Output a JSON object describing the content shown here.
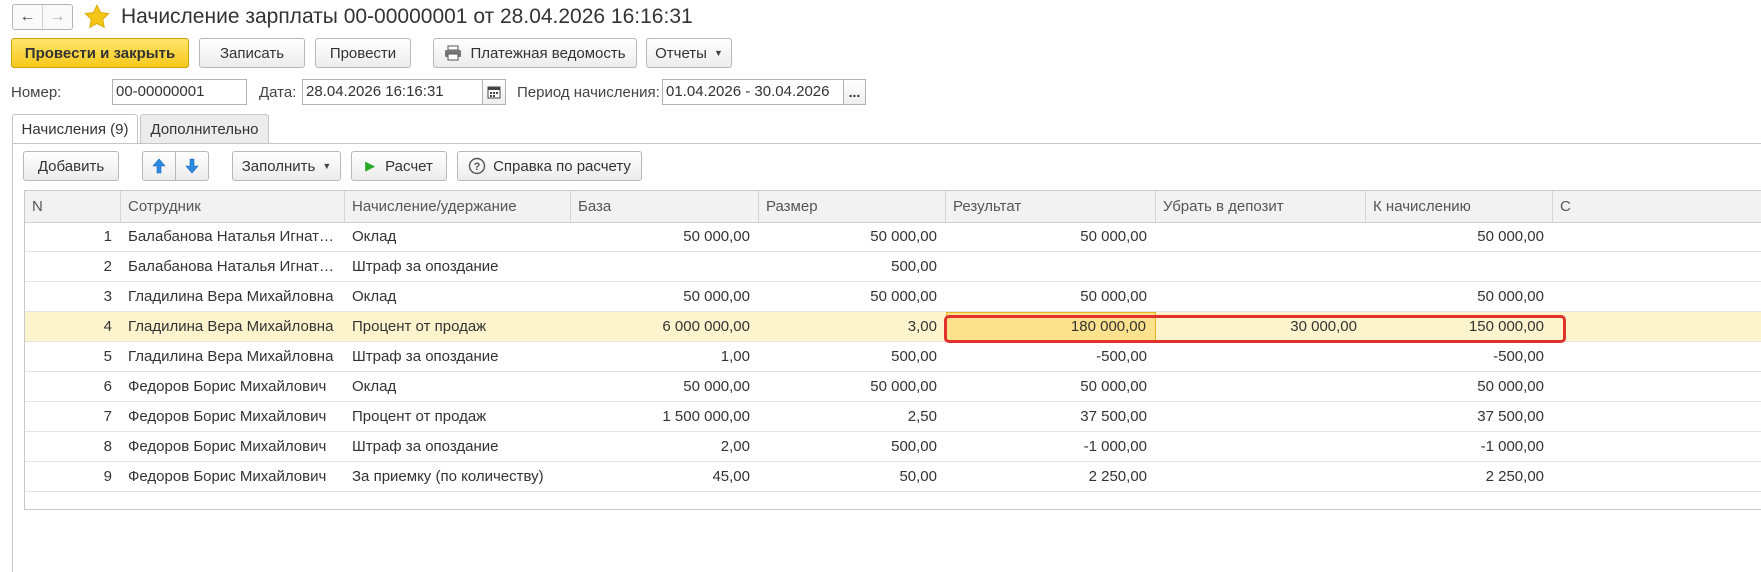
{
  "window": {
    "title": "Начисление зарплаты 00-00000001 от 28.04.2026 16:16:31",
    "back_icon": "arrow-left-icon",
    "forward_icon": "arrow-right-icon",
    "favorite_icon": "star-icon"
  },
  "toolbar": {
    "post_and_close": "Провести и закрыть",
    "save": "Записать",
    "post": "Провести",
    "payroll_statement": "Платежная ведомость",
    "reports": "Отчеты"
  },
  "header": {
    "number_label": "Номер:",
    "number_value": "00-00000001",
    "date_label": "Дата:",
    "date_value": "28.04.2026 16:16:31",
    "period_label": "Период начисления:",
    "period_value": "01.04.2026 - 30.04.2026",
    "period_more": "..."
  },
  "tabs": [
    {
      "label": "Начисления (9)",
      "active": true
    },
    {
      "label": "Дополнительно",
      "active": false
    }
  ],
  "table_toolbar": {
    "add": "Добавить",
    "fill": "Заполнить",
    "calculate": "Расчет",
    "calc_help": "Справка по расчету"
  },
  "columns": [
    "N",
    "Сотрудник",
    "Начисление/удержание",
    "База",
    "Размер",
    "Результат",
    "Убрать в депозит",
    "К начислению",
    "С"
  ],
  "rows": [
    {
      "n": "1",
      "employee": "Балабанова Наталья Игнат…",
      "accrual": "Оклад",
      "base": "50 000,00",
      "size": "50 000,00",
      "result": "50 000,00",
      "deposit": "",
      "to_accrue": "50 000,00"
    },
    {
      "n": "2",
      "employee": "Балабанова Наталья Игнат…",
      "accrual": "Штраф за опоздание",
      "base": "",
      "size": "500,00",
      "result": "",
      "deposit": "",
      "to_accrue": ""
    },
    {
      "n": "3",
      "employee": "Гладилина Вера Михайловна",
      "accrual": "Оклад",
      "base": "50 000,00",
      "size": "50 000,00",
      "result": "50 000,00",
      "deposit": "",
      "to_accrue": "50 000,00"
    },
    {
      "n": "4",
      "employee": "Гладилина Вера Михайловна",
      "accrual": "Процент от продаж",
      "base": "6 000 000,00",
      "size": "3,00",
      "result": "180 000,00",
      "deposit": "30 000,00",
      "to_accrue": "150 000,00"
    },
    {
      "n": "5",
      "employee": "Гладилина Вера Михайловна",
      "accrual": "Штраф за опоздание",
      "base": "1,00",
      "size": "500,00",
      "result": "-500,00",
      "deposit": "",
      "to_accrue": "-500,00"
    },
    {
      "n": "6",
      "employee": "Федоров Борис Михайлович",
      "accrual": "Оклад",
      "base": "50 000,00",
      "size": "50 000,00",
      "result": "50 000,00",
      "deposit": "",
      "to_accrue": "50 000,00"
    },
    {
      "n": "7",
      "employee": "Федоров Борис Михайлович",
      "accrual": "Процент от продаж",
      "base": "1 500 000,00",
      "size": "2,50",
      "result": "37 500,00",
      "deposit": "",
      "to_accrue": "37 500,00"
    },
    {
      "n": "8",
      "employee": "Федоров Борис Михайлович",
      "accrual": "Штраф за опоздание",
      "base": "2,00",
      "size": "500,00",
      "result": "-1 000,00",
      "deposit": "",
      "to_accrue": "-1 000,00"
    },
    {
      "n": "9",
      "employee": "Федоров Борис Михайлович",
      "accrual": "За приемку (по количеству)",
      "base": "45,00",
      "size": "50,00",
      "result": "2 250,00",
      "deposit": "",
      "to_accrue": "2 250,00"
    }
  ],
  "selected_row": 4,
  "colors": {
    "primary_button": "#f7c91c",
    "selected_row": "#fdf4cd",
    "active_cell": "#fde28d",
    "highlight_frame": "#e0322a"
  }
}
